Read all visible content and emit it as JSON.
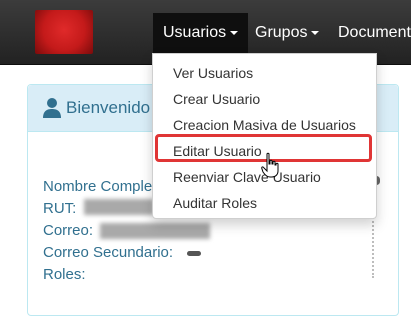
{
  "navbar": {
    "items": [
      {
        "label": "Usuarios",
        "has_caret": true,
        "active": true
      },
      {
        "label": "Grupos",
        "has_caret": true,
        "active": false
      },
      {
        "label": "Document",
        "has_caret": false,
        "active": false
      }
    ]
  },
  "dropdown": {
    "items": [
      {
        "label": "Ver Usuarios"
      },
      {
        "label": "Crear Usuario"
      },
      {
        "label": "Creacion Masiva de Usuarios"
      },
      {
        "label": "Editar Usuario",
        "highlighted": true
      },
      {
        "label": "Reenviar Clave Usuario"
      },
      {
        "label": "Auditar Roles"
      }
    ]
  },
  "panel": {
    "title": "Bienvenido",
    "lines": [
      {
        "label": "Nombre Comple"
      },
      {
        "label": "RUT:"
      },
      {
        "label": "Correo:"
      },
      {
        "label": "Correo Secundario:"
      },
      {
        "label": "Roles:"
      }
    ]
  },
  "colors": {
    "navbar_bg": "#2b2b2b",
    "active_nav_bg": "#0f0f0f",
    "panel_heading_bg": "#d9edf7",
    "panel_text": "#31708f",
    "highlight_border": "#e03535"
  }
}
